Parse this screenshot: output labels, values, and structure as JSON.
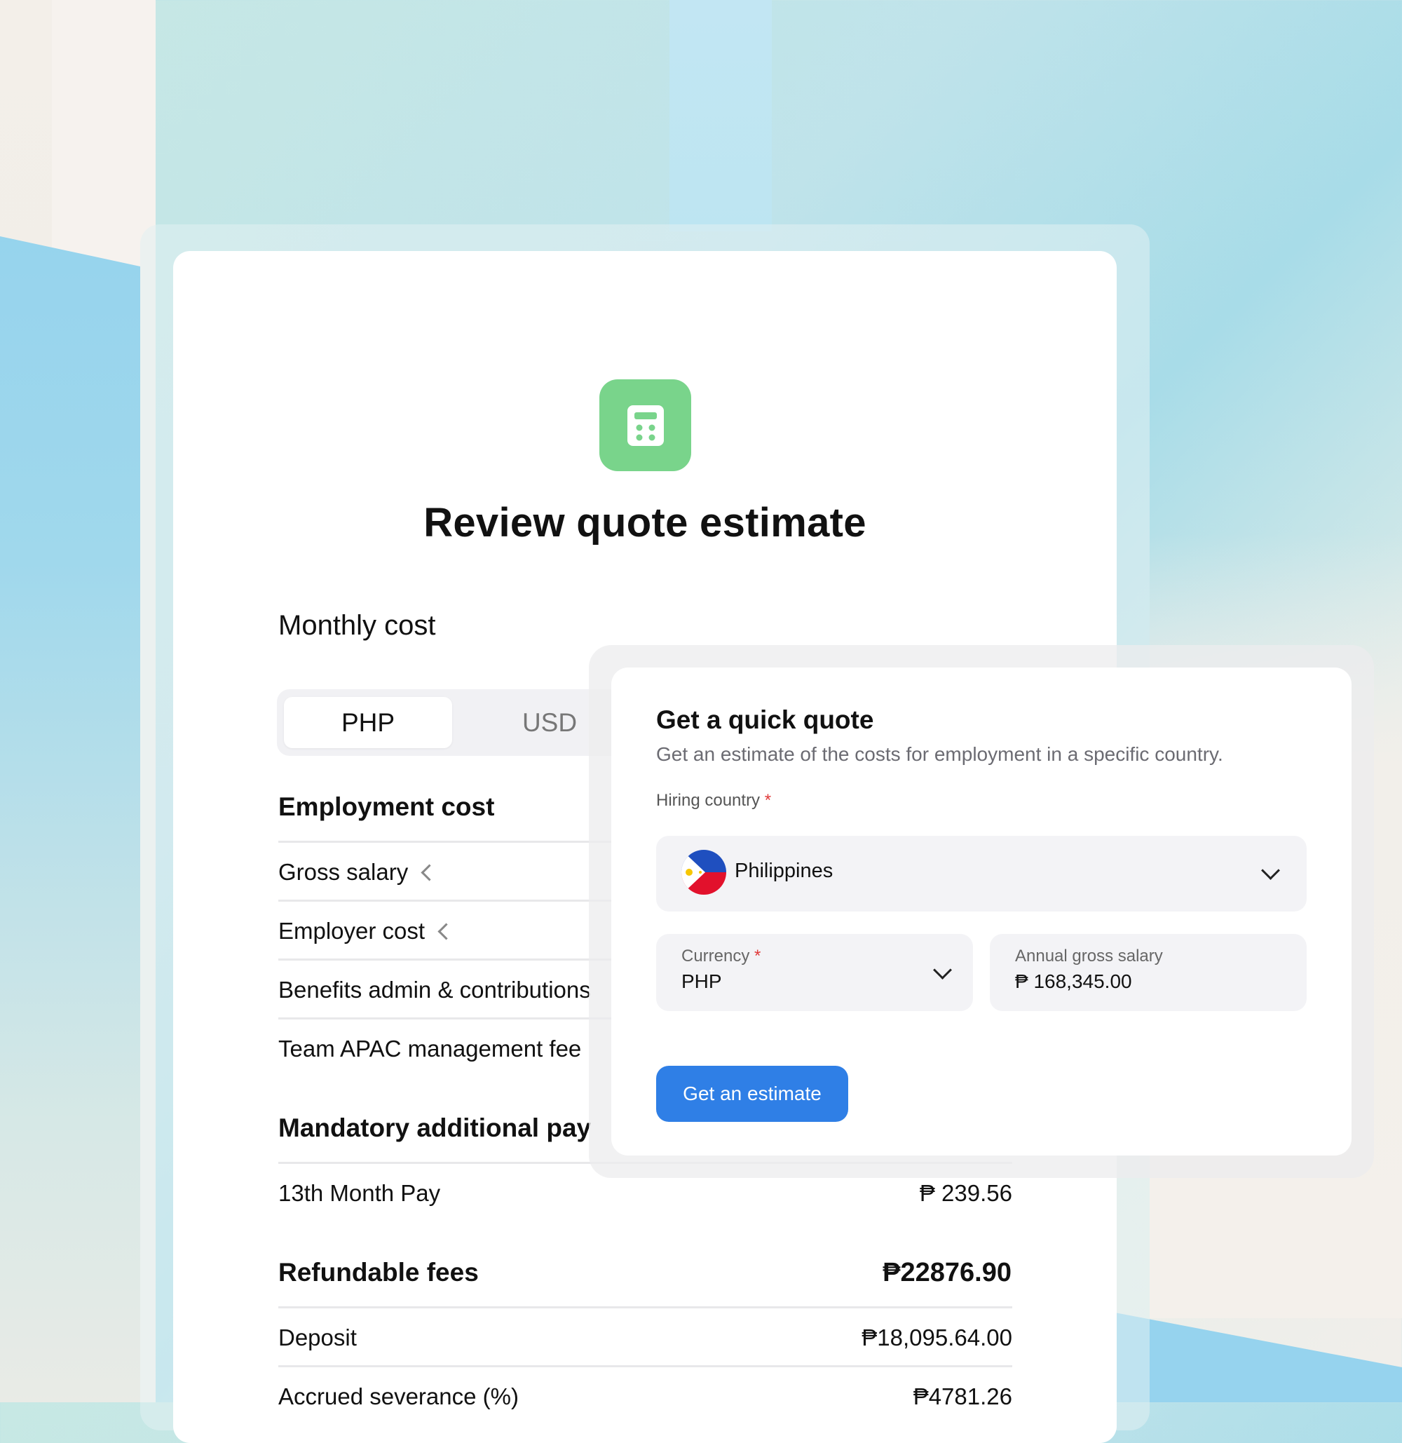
{
  "review": {
    "title": "Review quote estimate",
    "monthly_cost_heading": "Monthly cost",
    "currency_toggle": {
      "options": [
        "PHP",
        "USD"
      ],
      "selected": "PHP"
    },
    "employment_cost": {
      "heading": "Employment cost",
      "rows": [
        "Gross salary",
        "Employer cost",
        "Benefits admin & contributions",
        "Team APAC management fee"
      ]
    },
    "mandatory": {
      "heading": "Mandatory additional pay",
      "rows": [
        {
          "label": "13th Month Pay",
          "value": "₱ 239.56"
        }
      ]
    },
    "refundable": {
      "heading": "Refundable fees",
      "total": "₱22876.90",
      "rows": [
        {
          "label": "Deposit",
          "value": "₱18,095.64.00"
        },
        {
          "label": "Accrued severance (%)",
          "value": "₱4781.26"
        }
      ]
    }
  },
  "quote": {
    "title": "Get a quick quote",
    "subtitle": "Get an estimate of the costs for employment in a specific country.",
    "hiring_country_label": "Hiring country",
    "required_mark": "*",
    "country": "Philippines",
    "currency_label": "Currency",
    "currency_value": "PHP",
    "salary_label": "Annual gross salary",
    "salary_value": "₱ 168,345.00",
    "button": "Get an estimate"
  },
  "icons": {
    "badge": "calculator-icon",
    "collapse": "chevron-left-icon",
    "dropdown": "chevron-down-icon",
    "flag": "philippines-flag-icon"
  },
  "colors": {
    "accent_green": "#79d48b",
    "button_blue": "#2f7fe6",
    "required_red": "#e03a3a"
  }
}
